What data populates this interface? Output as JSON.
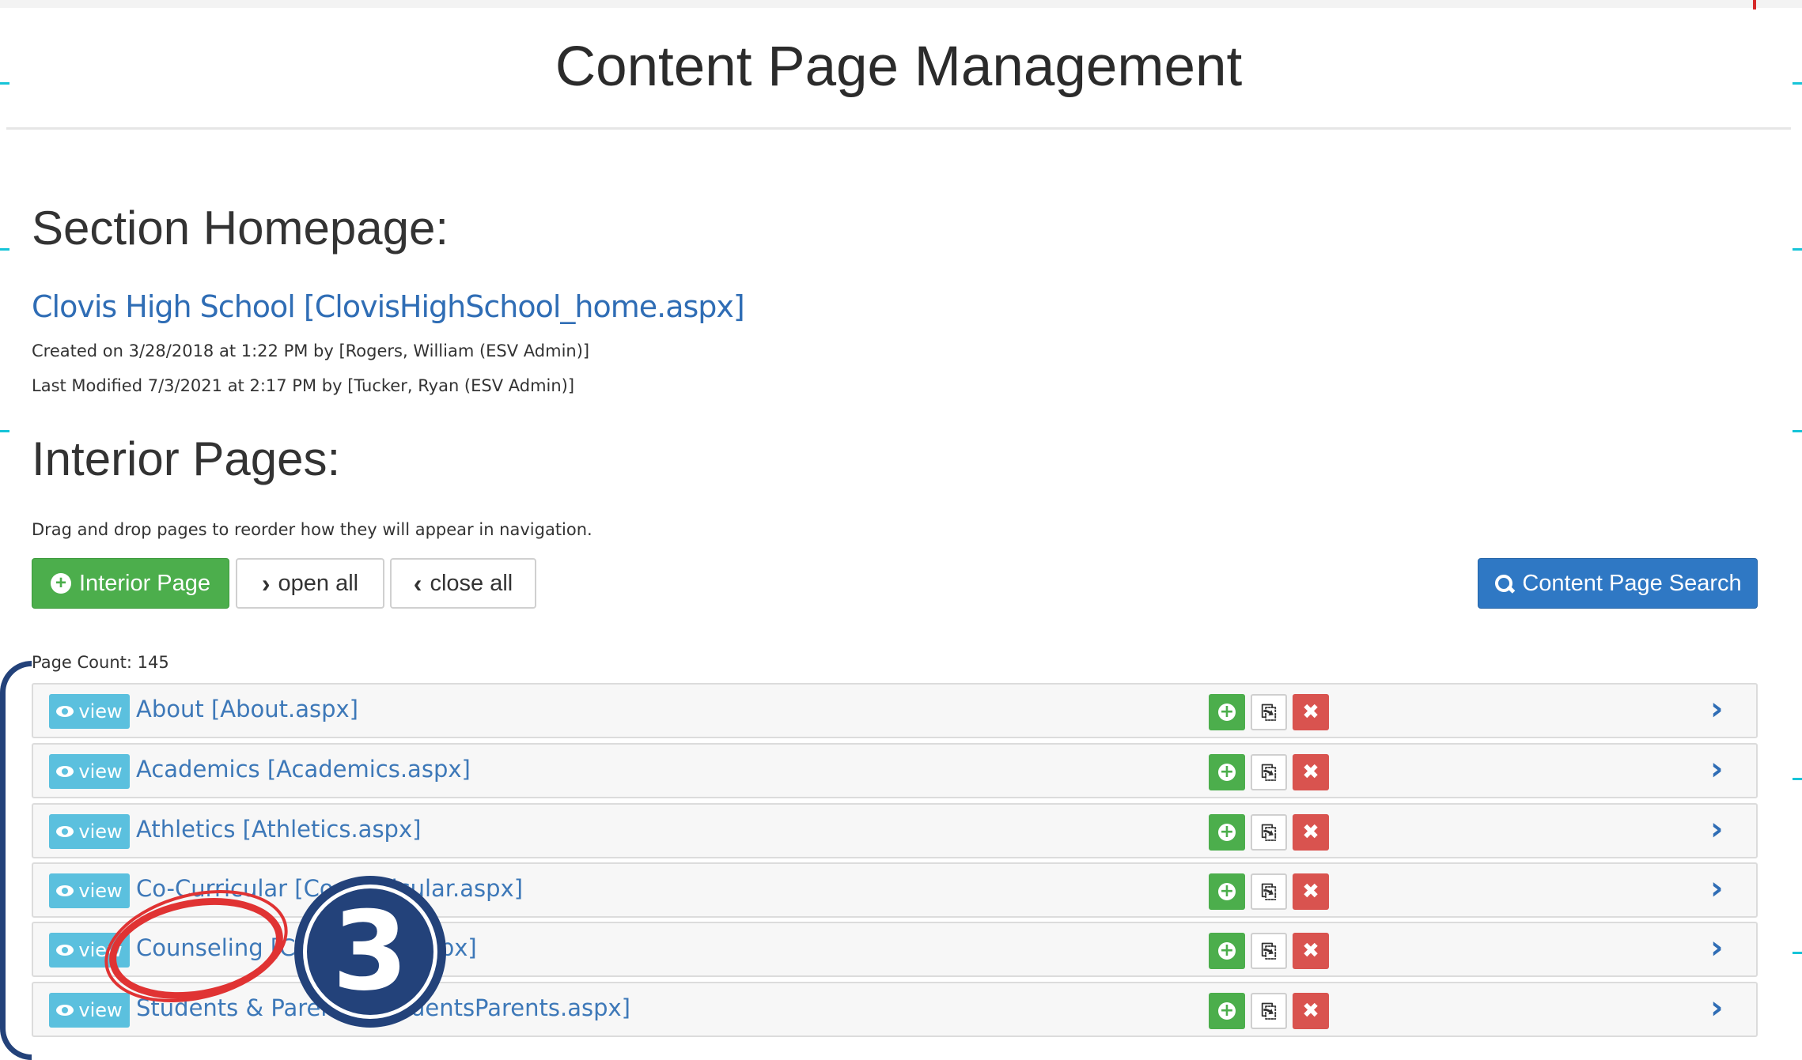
{
  "header": {
    "title": "Content Page Management"
  },
  "section_homepage": {
    "heading": "Section Homepage:",
    "link": "Clovis High School [ClovisHighSchool_home.aspx]",
    "created": "Created on 3/28/2018 at 1:22 PM by [Rogers, William (ESV Admin)]",
    "modified": "Last Modified 7/3/2021 at 2:17 PM by [Tucker, Ryan (ESV Admin)]"
  },
  "interior": {
    "heading": "Interior Pages:",
    "hint": "Drag and drop pages to reorder how they will appear in navigation.",
    "add_label": "Interior Page",
    "open_label": "open all",
    "close_label": "close all",
    "search_label": "Content Page Search",
    "count": "Page Count: 145"
  },
  "rows": [
    {
      "view": "view",
      "label": "About [About.aspx]"
    },
    {
      "view": "view",
      "label": "Academics [Academics.aspx]"
    },
    {
      "view": "view",
      "label": "Athletics [Athletics.aspx]"
    },
    {
      "view": "view",
      "label": "Co-Curricular [Co-Curricular.aspx]"
    },
    {
      "view": "view",
      "label": "Counseling [Counseling.aspx]"
    },
    {
      "view": "view",
      "label": "Students & Parents [StudentsParents.aspx]"
    }
  ],
  "annotation": {
    "step": "3"
  },
  "colors": {
    "accent_green": "#4cae4c",
    "accent_blue": "#2f78c4",
    "info": "#5bc0de",
    "danger": "#d9534f",
    "annotation_navy": "#23427a",
    "annotation_red": "#e03333"
  }
}
